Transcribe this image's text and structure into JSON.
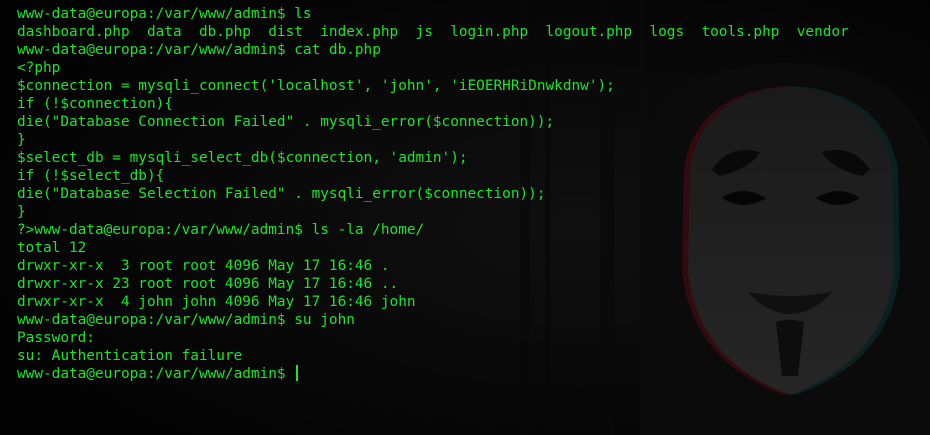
{
  "terminal": {
    "lines": [
      "www-data@europa:/var/www/admin$ ls",
      "dashboard.php  data  db.php  dist  index.php  js  login.php  logout.php  logs  tools.php  vendor",
      "www-data@europa:/var/www/admin$ cat db.php",
      "<?php",
      "$connection = mysqli_connect('localhost', 'john', 'iEOERHRiDnwkdnw');",
      "if (!$connection){",
      "die(\"Database Connection Failed\" . mysqli_error($connection));",
      "}",
      "$select_db = mysqli_select_db($connection, 'admin');",
      "if (!$select_db){",
      "die(\"Database Selection Failed\" . mysqli_error($connection));",
      "}",
      "?>www-data@europa:/var/www/admin$ ls -la /home/",
      "total 12",
      "drwxr-xr-x  3 root root 4096 May 17 16:46 .",
      "drwxr-xr-x 23 root root 4096 May 17 16:46 ..",
      "drwxr-xr-x  4 john john 4096 May 17 16:46 john",
      "www-data@europa:/var/www/admin$ su john",
      "Password:",
      "su: Authentication failure",
      "www-data@europa:/var/www/admin$ "
    ]
  },
  "wallpaper": {
    "icon": "masked-face-icon"
  },
  "colors": {
    "background": "#030303",
    "text": "#1de52a",
    "cursor": "#1de52a",
    "wallpaper_mask": "#1c1c1c",
    "wallpaper_shadow": "#0a0a0a",
    "wallpaper_red_glitch": "#3a0a10",
    "wallpaper_cyan_glitch": "#0c2a2a"
  }
}
